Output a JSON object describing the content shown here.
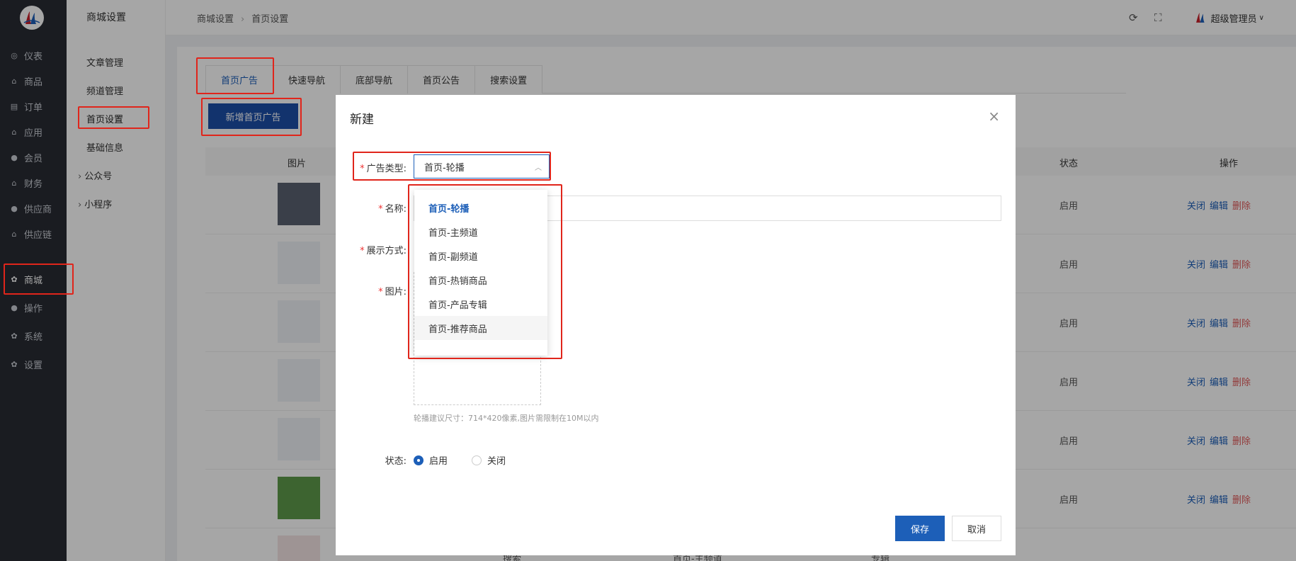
{
  "sidebar": {
    "items": [
      {
        "icon": "dashboard-icon",
        "label": "仪表"
      },
      {
        "icon": "bag-icon",
        "label": "商品"
      },
      {
        "icon": "order-icon",
        "label": "订单"
      },
      {
        "icon": "bag-icon",
        "label": "应用"
      },
      {
        "icon": "user-icon",
        "label": "会员"
      },
      {
        "icon": "bag-icon",
        "label": "财务"
      },
      {
        "icon": "user-icon",
        "label": "供应商"
      },
      {
        "icon": "bag-icon",
        "label": "供应链"
      },
      {
        "icon": "gear-icon",
        "label": "商城"
      },
      {
        "icon": "user-icon",
        "label": "操作"
      },
      {
        "icon": "gear-icon",
        "label": "系统"
      },
      {
        "icon": "gear-icon",
        "label": "设置"
      }
    ]
  },
  "subsidebar": {
    "title": "商城设置",
    "items": [
      "文章管理",
      "频道管理",
      "首页设置",
      "基础信息",
      "公众号",
      "小程序"
    ]
  },
  "header": {
    "crumb1": "商城设置",
    "crumb2": "首页设置",
    "user": "超级管理员"
  },
  "tabs": [
    "首页广告",
    "快速导航",
    "底部导航",
    "首页公告",
    "搜索设置"
  ],
  "add_button": "新增首页广告",
  "table": {
    "col_image": "图片",
    "col_status": "状态",
    "col_ops": "操作",
    "rows": [
      {
        "status": "启用"
      },
      {
        "status": "启用"
      },
      {
        "status": "启用"
      },
      {
        "status": "启用"
      },
      {
        "status": "启用"
      },
      {
        "status": "启用"
      }
    ],
    "ops": {
      "close": "关闭",
      "edit": "编辑",
      "delete": "删除"
    },
    "partial_row": [
      "搜索",
      "首页-主频道",
      "专辑"
    ]
  },
  "modal": {
    "title": "新建",
    "field_type_label": "广告类型:",
    "field_type_value": "首页-轮播",
    "field_name_label": "名称:",
    "field_display_label": "展示方式:",
    "field_image_label": "图片:",
    "hint": "轮播建议尺寸：714*420像素,图片需限制在10M以内",
    "status_label": "状态:",
    "radio_on": "启用",
    "radio_off": "关闭",
    "save": "保存",
    "cancel": "取消"
  },
  "dropdown": {
    "options": [
      "首页-轮播",
      "首页-主频道",
      "首页-副频道",
      "首页-热销商品",
      "首页-产品专辑",
      "首页-推荐商品"
    ]
  },
  "colors": {
    "primary": "#1d5fb8",
    "sidebar_bg": "#282b33",
    "annotation": "#e0251b",
    "danger": "#e05a5a"
  }
}
